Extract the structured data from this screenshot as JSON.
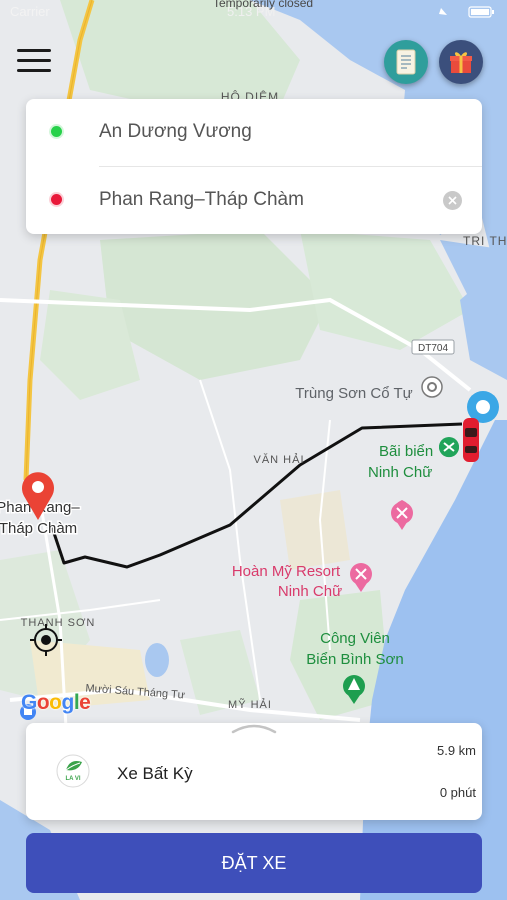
{
  "status_bar": {
    "carrier": "Carrier",
    "time": "5:13 PM",
    "notice": "Temporarily closed"
  },
  "header": {
    "menu_icon": "hamburger-menu-icon",
    "history_icon": "receipt-icon",
    "gift_icon": "gift-icon"
  },
  "route": {
    "origin": "An Dương Vương",
    "destination": "Phan Rang–Tháp Chàm",
    "origin_color": "#27d14a",
    "destination_color": "#e9193a"
  },
  "map": {
    "labels": {
      "ho_diem": "HỘ DIÊM",
      "tri_thuy": "TRI TH",
      "dt704": "DT704",
      "trung_son": "Trùng Sơn Cổ Tự",
      "van_hai": "VĂN HẢI",
      "bai_bien_1": "Bãi biển",
      "bai_bien_2": "Ninh Chữ",
      "city_1": "Phan Rang–",
      "city_2": "Tháp Chàm",
      "resort_1": "Hoàn Mỹ Resort",
      "resort_2": "Ninh Chữ",
      "thanh_son": "THANH SƠN",
      "cong_vien_1": "Công Viên",
      "cong_vien_2": "Biển Bình Sơn",
      "muoi_sau": "Mười Sáu Tháng Tư",
      "my_hai": "MỸ HẢI",
      "google": "Google"
    },
    "route_color": "#111111"
  },
  "vehicle": {
    "name": "Xe Bất Kỳ",
    "distance": "5.9 km",
    "duration": "0 phút",
    "logo_text": "LA VI"
  },
  "actions": {
    "book_label": "ĐẶT XE"
  }
}
